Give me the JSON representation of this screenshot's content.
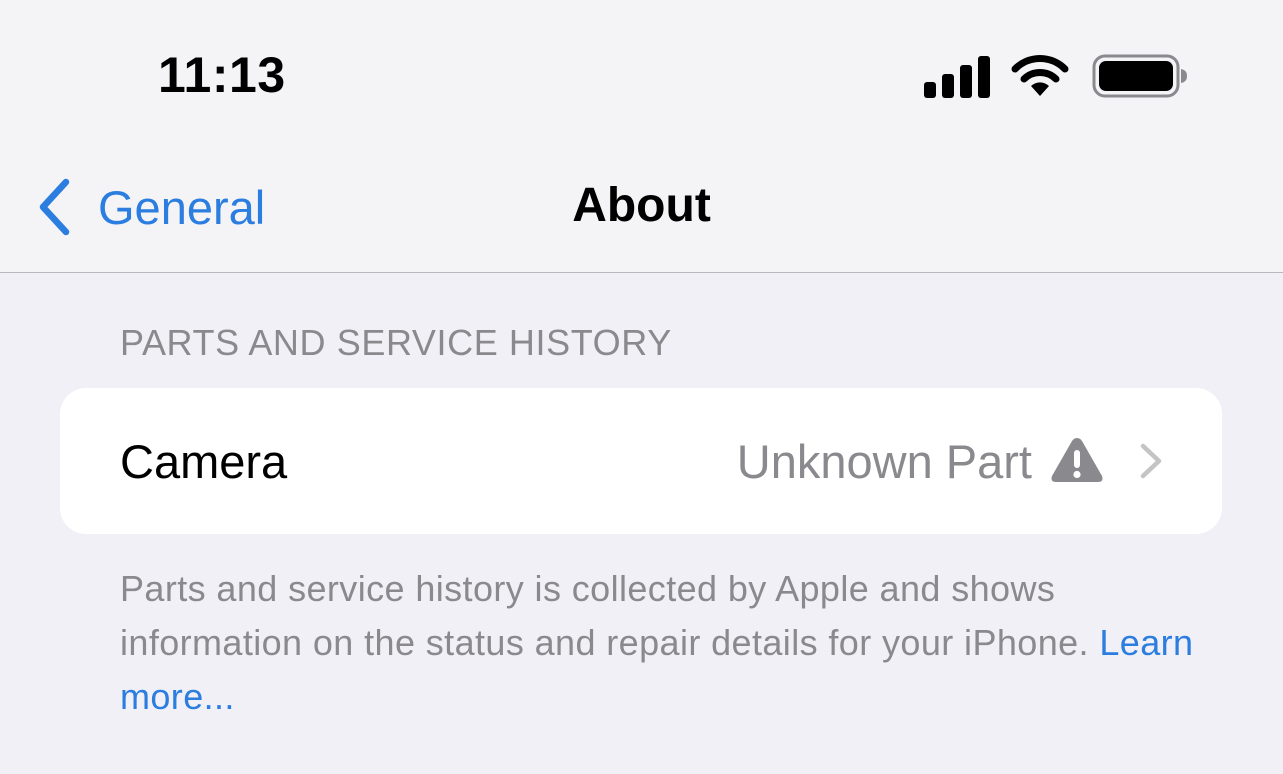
{
  "status_bar": {
    "time": "11:13",
    "icons": [
      "cellular-signal-icon",
      "wifi-icon",
      "battery-icon"
    ]
  },
  "nav": {
    "back_label": "General",
    "title": "About"
  },
  "section": {
    "header": "PARTS AND SERVICE HISTORY",
    "rows": [
      {
        "label": "Camera",
        "value": "Unknown Part",
        "icon": "warning-triangle-icon"
      }
    ],
    "footer_text": "Parts and service history is collected by Apple and shows information on the status and repair details for your iPhone. ",
    "footer_link": "Learn more..."
  },
  "colors": {
    "accent": "#2b7de0",
    "secondary_text": "#8a8a8e",
    "background": "#f0f0f6"
  }
}
